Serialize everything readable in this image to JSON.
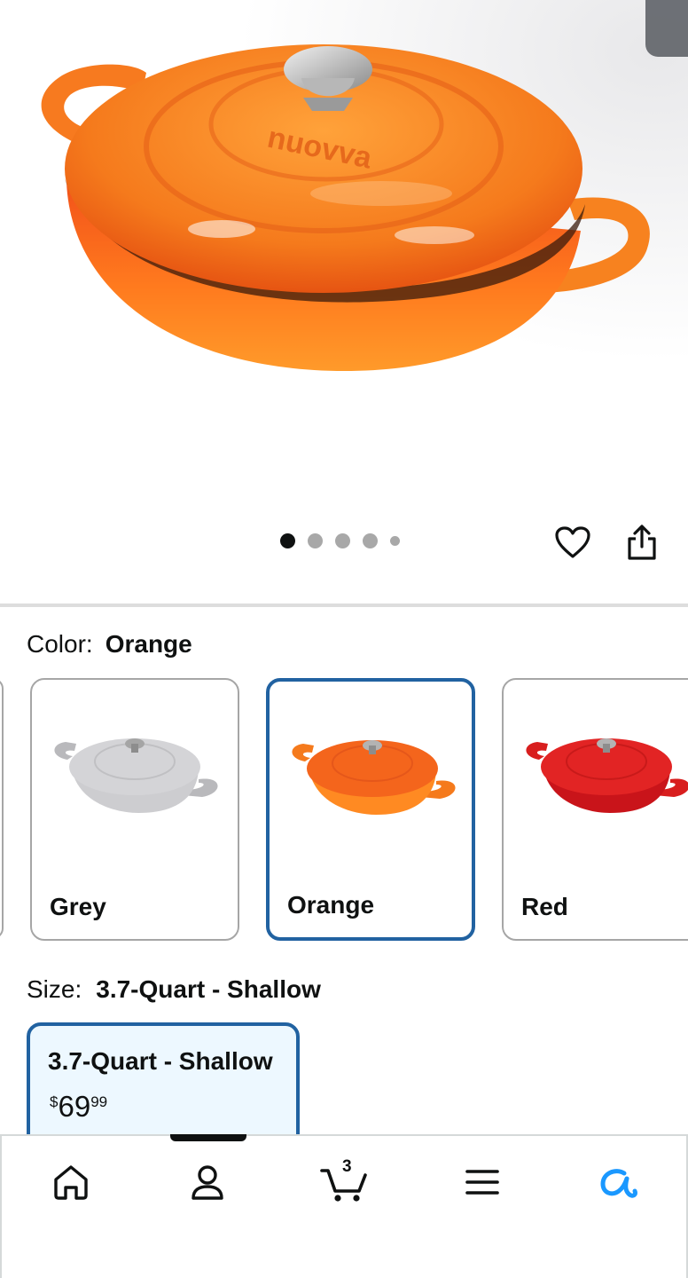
{
  "product": {
    "image_alt": "Orange enameled cast iron braiser with lid",
    "brand_emboss": "nuovva"
  },
  "carousel": {
    "total": 5,
    "active": 1
  },
  "actions": {
    "wishlist_icon": "heart-icon",
    "share_icon": "share-icon"
  },
  "color": {
    "label": "Color:",
    "selected": "Orange",
    "options": [
      {
        "name": "Grey",
        "color": "#c9c9cc"
      },
      {
        "name": "Orange",
        "color": "#f26a1b"
      },
      {
        "name": "Red",
        "color": "#d81e1e"
      }
    ]
  },
  "size": {
    "label": "Size:",
    "selected": "3.7-Quart - Shallow",
    "options": [
      {
        "name": "3.7-Quart - Shallow",
        "currency": "$",
        "price_whole": "69",
        "price_fraction": "99"
      }
    ]
  },
  "nav": {
    "items": [
      "home-icon",
      "account-icon",
      "cart-icon",
      "menu-icon",
      "rufus-icon"
    ],
    "cart_count": "3"
  },
  "colors": {
    "accent": "#2162a1",
    "selected_bg": "#edf8ff",
    "rufus": "#1a98ff"
  }
}
